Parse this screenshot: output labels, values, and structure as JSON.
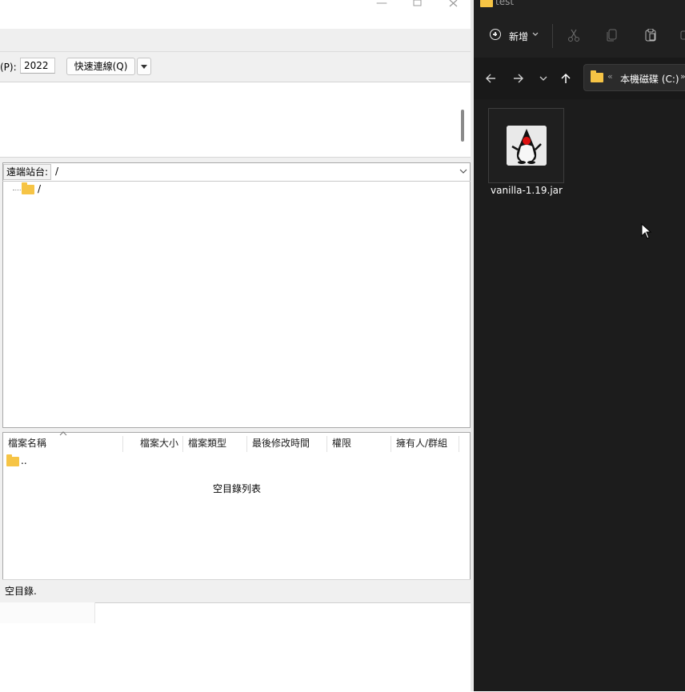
{
  "filezilla": {
    "quickconnect": {
      "port_label": "(P):",
      "port_value": "2022",
      "connect_button": "快速連線(Q)"
    },
    "remote": {
      "site_label": "遠端站台:",
      "path": "/",
      "tree_root": "/"
    },
    "file_list": {
      "columns": [
        "檔案名稱",
        "檔案大小",
        "檔案類型",
        "最後修改時間",
        "權限",
        "擁有人/群組"
      ],
      "parent_entry": "..",
      "empty_message": "空目錄列表"
    },
    "status_bar": "空目錄."
  },
  "explorer": {
    "window_title": "test",
    "command_bar": {
      "new_label": "新增",
      "icons": [
        "cut-icon",
        "copy-icon",
        "paste-icon"
      ]
    },
    "nav": {
      "icons": [
        "back-arrow-icon",
        "forward-arrow-icon",
        "recent-chevron-icon",
        "up-arrow-icon"
      ]
    },
    "address": {
      "separator": "«",
      "location": "本機磁碟 (C:)",
      "overflow": "»"
    },
    "files": [
      {
        "name": "vanilla-1.19.jar",
        "icon": "java-duke-icon"
      }
    ]
  },
  "colors": {
    "explorer_bg": "#1c1c1c",
    "folder_yellow": "#f6c445",
    "filezilla_panel": "#f0f0f0"
  }
}
